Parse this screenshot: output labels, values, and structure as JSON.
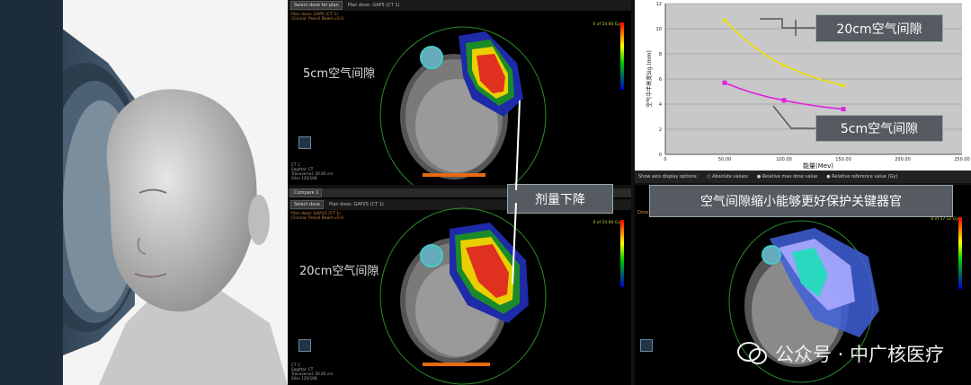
{
  "left_panel": {
    "description_icon": "gantry-face-illustration"
  },
  "top_pane": {
    "select_label": "Select dose for plan",
    "plan_dose": "Plan dose: GAP5 (CT 1)",
    "header_lines": [
      "Plan dose: GAP5 (CT 1)",
      "Clinical: Pencil Beam v3.0"
    ],
    "label": "5cm空气间隙",
    "info_lines": [
      "CT 1",
      "Sagittal: CT",
      "Transversal: 50.85 cm",
      "Slice 120/168"
    ],
    "scale_label": "0 of 54.60 Gy"
  },
  "bottom_pane": {
    "tab_label": "Compare 1",
    "select_label": "Select dose",
    "plan_dose": "Plan dose: GAP25 (CT 1)",
    "header_lines": [
      "Plan dose: GAP25 (CT 1)",
      "Clinical: Pencil Beam v3.0"
    ],
    "label": "20cm空气间隙",
    "info_lines": [
      "CT 1",
      "Sagittal: CT",
      "Transversal: 50.85 cm",
      "Slice 120/168"
    ],
    "scale_label": "0 of 54.60 Gy"
  },
  "right_bottom_pane": {
    "tab_label": "Dose",
    "scale_label": "0 of 57.12 Gy"
  },
  "callouts": {
    "dose_drop": "剂量下降",
    "protect": "空气间隙缩小能够更好保护关键器官",
    "gap20": "20cm空气间隙",
    "gap5": "5cm空气间隙"
  },
  "options": {
    "label": "Show axis display options:",
    "items": [
      "Absolute values",
      "Relative max dose value",
      "Relative reference value (Gy)"
    ]
  },
  "chart_data": {
    "type": "line",
    "xlabel": "能量(Mev)",
    "ylabel": "空气中半高宽Sig.(mm)",
    "xlim": [
      0,
      250
    ],
    "ylim": [
      0,
      12
    ],
    "xticks": [
      "0",
      "50.00",
      "100.00",
      "150.00",
      "200.00",
      "250.00"
    ],
    "yticks": [
      "0",
      "2",
      "4",
      "6",
      "8",
      "10",
      "12"
    ],
    "grid": true,
    "series": [
      {
        "name": "20cm空气间隙",
        "color": "#f0e000",
        "x": [
          50,
          100,
          150
        ],
        "y": [
          10.7,
          7.1,
          5.5
        ]
      },
      {
        "name": "5cm空气间隙",
        "color": "#e020e0",
        "x": [
          50,
          100,
          150
        ],
        "y": [
          5.7,
          4.3,
          3.6
        ]
      }
    ]
  },
  "watermark": {
    "text": "公众号 · 中广核医疗"
  }
}
